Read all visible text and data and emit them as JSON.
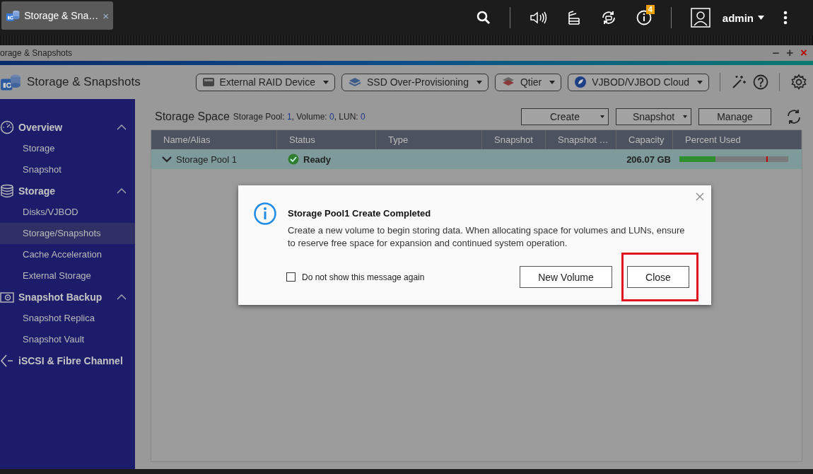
{
  "top_bar": {
    "tab": {
      "title": "Storage & Sna…",
      "close": "×"
    },
    "notification_count": "4",
    "user": "admin"
  },
  "window": {
    "title": "orage & Snapshots",
    "controls": [
      "–",
      "+",
      "×"
    ]
  },
  "app_header": {
    "title": "Storage & Snapshots",
    "toolbar": [
      "External RAID Device",
      "SSD Over-Provisioning",
      "Qtier",
      "VJBOD/VJBOD Cloud"
    ]
  },
  "sidebar": {
    "groups": [
      {
        "label": "Overview",
        "expanded": true,
        "children": [
          {
            "label": "Storage",
            "selected": false
          },
          {
            "label": "Snapshot",
            "selected": false
          }
        ]
      },
      {
        "label": "Storage",
        "expanded": true,
        "children": [
          {
            "label": "Disks/VJBOD",
            "selected": false
          },
          {
            "label": "Storage/Snapshots",
            "selected": true
          },
          {
            "label": "Cache Acceleration",
            "selected": false
          },
          {
            "label": "External Storage",
            "selected": false
          }
        ]
      },
      {
        "label": "Snapshot Backup",
        "expanded": true,
        "children": [
          {
            "label": "Snapshot Replica",
            "selected": false
          },
          {
            "label": "Snapshot Vault",
            "selected": false
          }
        ]
      },
      {
        "label": "iSCSI & Fibre Channel"
      }
    ]
  },
  "panel": {
    "title": "Storage Space",
    "summary": [
      {
        "label": "Storage Pool:",
        "value": "1"
      },
      {
        "label": ", Volume:",
        "value": "0"
      },
      {
        "label": ", LUN:",
        "value": "0"
      }
    ],
    "buttons": [
      {
        "label": "Create",
        "dropdown": true
      },
      {
        "label": "Snapshot",
        "dropdown": true
      },
      {
        "label": "Manage",
        "dropdown": false
      }
    ]
  },
  "table": {
    "columns": [
      "Name/Alias",
      "Status",
      "Type",
      "Snapshot",
      "Snapshot …",
      "Capacity",
      "Percent Used"
    ],
    "rows": [
      {
        "name": "Storage Pool 1",
        "expanded": true,
        "status": "Ready",
        "capacity": "206.07 GB",
        "level": 0.33,
        "selected": true
      }
    ]
  },
  "dialog": {
    "title": "Storage Pool1 Create Completed",
    "message": "Create a new volume to begin storing data. When allocating space for volumes and LUNs, ensure to reserve free space for expansion and continued system operation.",
    "checkbox": {
      "label": "Do not show this message again",
      "checked": false
    },
    "buttons": [
      {
        "label": "New Volume",
        "highlighted": false
      },
      {
        "label": "Close",
        "highlighted": true
      }
    ]
  }
}
